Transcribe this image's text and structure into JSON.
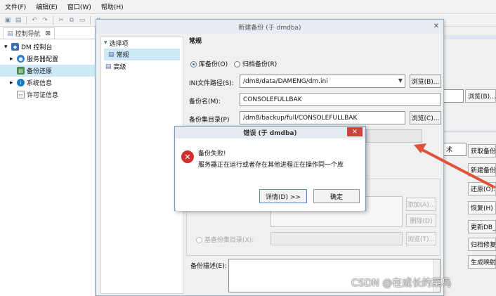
{
  "menu": [
    {
      "label": "文件(F)"
    },
    {
      "label": "编辑(E)"
    },
    {
      "label": "窗口(W)"
    },
    {
      "label": "帮助(H)"
    }
  ],
  "nav": {
    "tab_label": "控制导航",
    "tab_close": "⊠",
    "tree": [
      {
        "label": "DM 控制台",
        "expander": "▾",
        "icon": "dm-console-icon"
      },
      {
        "label": "服务器配置",
        "expander": "▸",
        "icon": "server-config-icon"
      },
      {
        "label": "备份还原",
        "expander": "",
        "icon": "backup-icon",
        "selected": true
      },
      {
        "label": "系统信息",
        "expander": "▸",
        "icon": "info-icon"
      },
      {
        "label": "许可证信息",
        "expander": "",
        "icon": "license-icon"
      }
    ]
  },
  "background": {
    "browse_label": "浏览(B)...",
    "unit_label": "兆",
    "field_fragment": "术",
    "buttons": [
      "获取备份",
      "新建备份",
      "还原(O)...",
      "恢复(H)",
      "更新DB_",
      "归档修复",
      "生成映射"
    ]
  },
  "dialog": {
    "title": "新建备份 (于 dmdba)",
    "close_glyph": "✕",
    "options_header": "选择项",
    "options_header_glyph": "▾",
    "options": [
      {
        "label": "常规",
        "selected": true
      },
      {
        "label": "高级",
        "selected": false
      }
    ],
    "section_title": "常规",
    "backup_type": {
      "library": "库备份(O)",
      "archive": "归档备份(R)"
    },
    "ini_path": {
      "label": "INI文件路径(S):",
      "value": "/dm8/data/DAMENG/dm.ini",
      "browse": "浏览(B)..."
    },
    "backup_name": {
      "label": "备份名(M):",
      "value": "CONSOLEFULLBAK"
    },
    "backup_dir": {
      "label": "备份集目录(P)",
      "value": "/dm8/backup/full/CONSOLEFULLBAK",
      "browse": "浏览(C)..."
    },
    "add_btn": "添加(A)...",
    "delete_btn": "删除(D)",
    "base_dir": {
      "label": "基备份集目录(X):",
      "browse": "浏览(T)..."
    },
    "description": {
      "label": "备份描述(E):"
    }
  },
  "error": {
    "title": "错误  (于 dmdba)",
    "close_glyph": "✕",
    "heading": "备份失败!",
    "message": "服务器正在运行或者存在其他进程正在操作同一个库",
    "details_button": "详情(D) >>",
    "ok_button": "确定",
    "accent": "#d32f2f"
  },
  "watermark": "CSDN @在成长的菜鸟",
  "annotation_color": "#e0533a"
}
